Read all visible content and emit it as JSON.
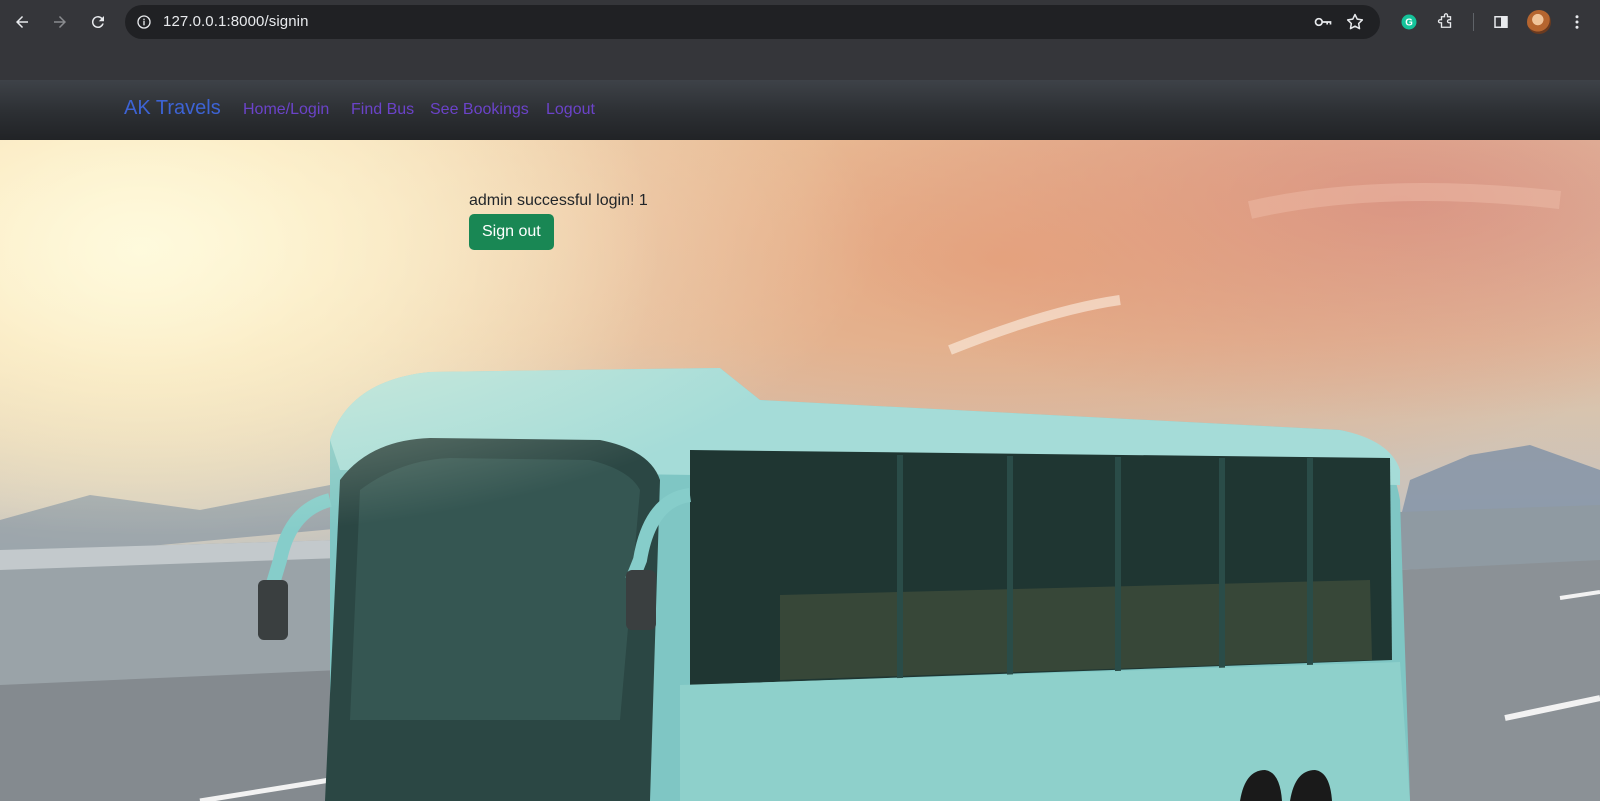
{
  "browser": {
    "url": "127.0.0.1:8000/signin"
  },
  "navbar": {
    "brand": "AK Travels",
    "links": [
      "Home/Login",
      "Find Bus",
      "See Bookings",
      "Logout"
    ]
  },
  "main": {
    "message": "admin successful login! 1",
    "signout_label": "Sign out"
  },
  "colors": {
    "brand": "#3d63d4",
    "nav_link": "#6b43c9",
    "button": "#198754"
  }
}
